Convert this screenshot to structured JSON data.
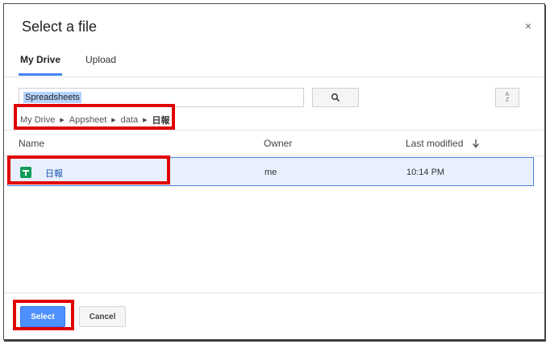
{
  "dialog": {
    "title": "Select a file",
    "close_icon": "×"
  },
  "tabs": [
    {
      "label": "My Drive",
      "active": true
    },
    {
      "label": "Upload",
      "active": false
    }
  ],
  "search": {
    "value": "Spreadsheets"
  },
  "breadcrumb": [
    "My Drive",
    "Appsheet",
    "data",
    "日報"
  ],
  "columns": {
    "name": "Name",
    "owner": "Owner",
    "modified": "Last modified"
  },
  "rows": [
    {
      "name": "日報",
      "owner": "me",
      "modified": "10:14 PM",
      "icon": "google-sheets-icon",
      "selected": true
    }
  ],
  "buttons": {
    "select": "Select",
    "cancel": "Cancel"
  },
  "sort_button": {
    "top": "A",
    "bottom": "Z"
  },
  "colors": {
    "accent": "#4285f4",
    "highlight_box": "#e00000",
    "selected_row": "#e8f0fe",
    "sheets_green": "#0f9d58"
  }
}
